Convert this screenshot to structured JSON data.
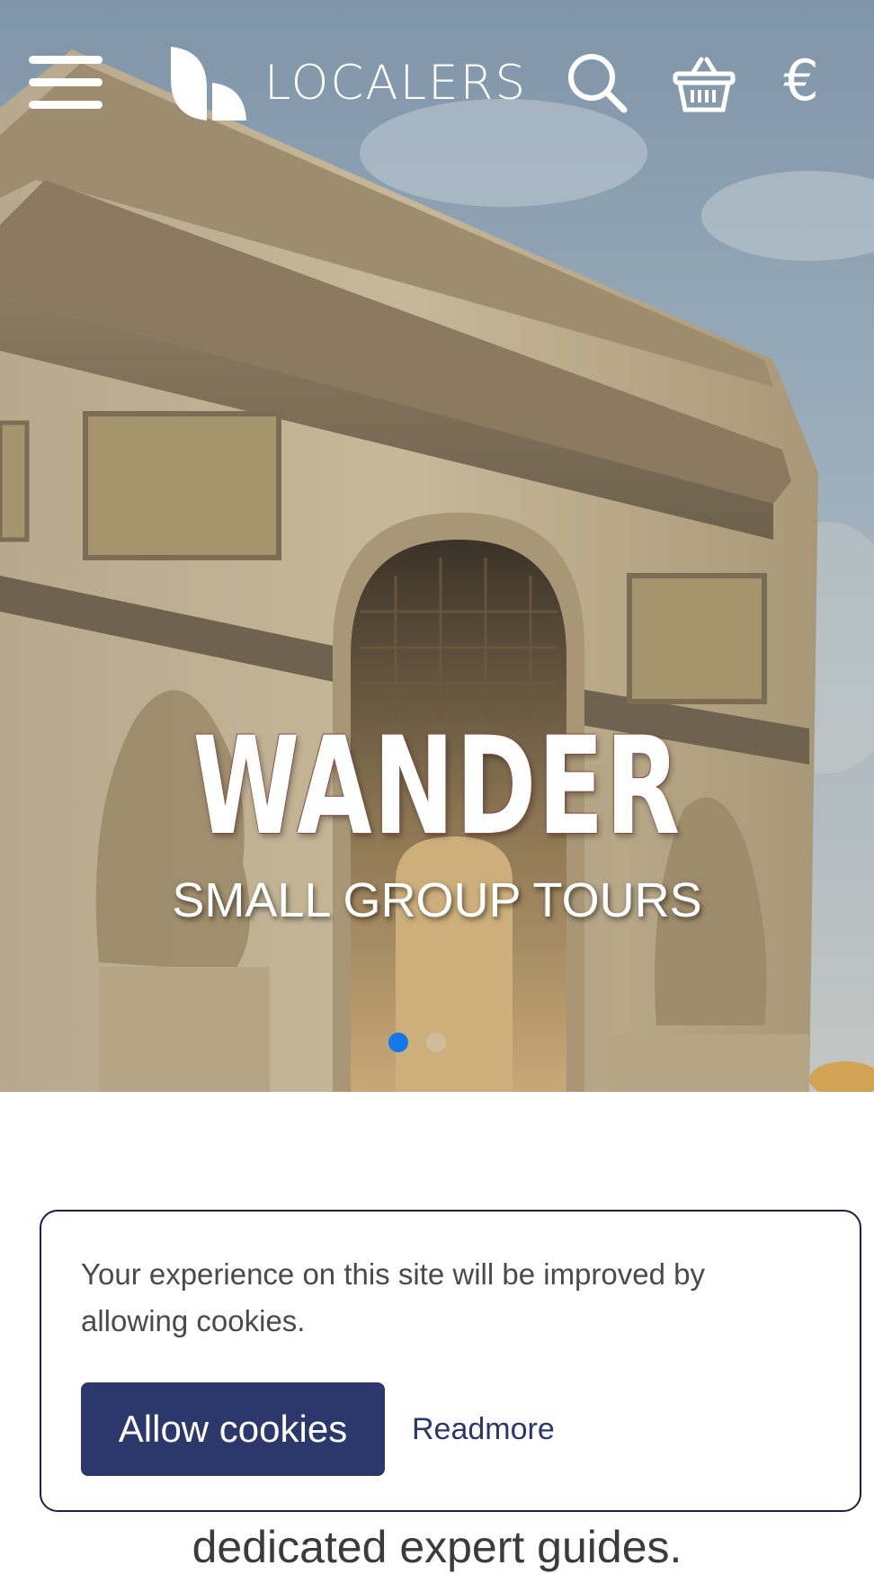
{
  "header": {
    "brand": "LOCALERS",
    "currency_symbol": "€",
    "icons": [
      "menu-icon",
      "logo-icon",
      "search-icon",
      "basket-icon",
      "euro-icon"
    ]
  },
  "hero": {
    "title": "WANDER",
    "subtitle": "SMALL GROUP TOURS",
    "slides_total": 2,
    "active_slide": 1,
    "active_dot_color": "#1478e8"
  },
  "partial_text": "dedicated expert guides.",
  "cookie_banner": {
    "message": "Your experience on this site will be improved by allowing cookies.",
    "allow_label": "Allow cookies",
    "readmore_label": "Readmore",
    "button_color": "#2c376c",
    "border_color": "#1b1f4a"
  }
}
